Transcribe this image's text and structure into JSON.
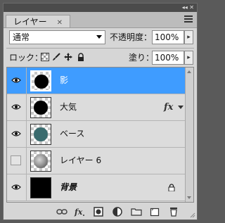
{
  "panel": {
    "dock_controls": "◂◂ ✕",
    "tab_label": "レイヤー",
    "tab_close": "✕"
  },
  "blend": {
    "mode": "通常",
    "opacity_label": "不透明度：",
    "opacity_value": "100%"
  },
  "lock": {
    "label": "ロック：",
    "fill_label": "塗り：",
    "fill_value": "100%"
  },
  "layers": [
    {
      "name": "影",
      "visible": true,
      "selected": true,
      "thumb": "black-circle"
    },
    {
      "name": "大気",
      "visible": true,
      "selected": false,
      "thumb": "black-circle",
      "fx": "fx"
    },
    {
      "name": "ベース",
      "visible": true,
      "selected": false,
      "thumb": "teal-circle"
    },
    {
      "name": "レイヤー 6",
      "visible": false,
      "selected": false,
      "thumb": "textured-circle"
    },
    {
      "name": "背景",
      "visible": true,
      "selected": false,
      "thumb": "solid-black",
      "locked": true
    }
  ],
  "colors": {
    "selection": "#3f9cff",
    "teal_disk": "#3a6b6e",
    "panel_bg": "#d6d6d6"
  },
  "icons": {
    "footer": [
      "link-layers-icon",
      "fx-icon",
      "layer-mask-icon",
      "adjustment-layer-icon",
      "new-group-icon",
      "new-layer-icon",
      "trash-icon"
    ]
  }
}
